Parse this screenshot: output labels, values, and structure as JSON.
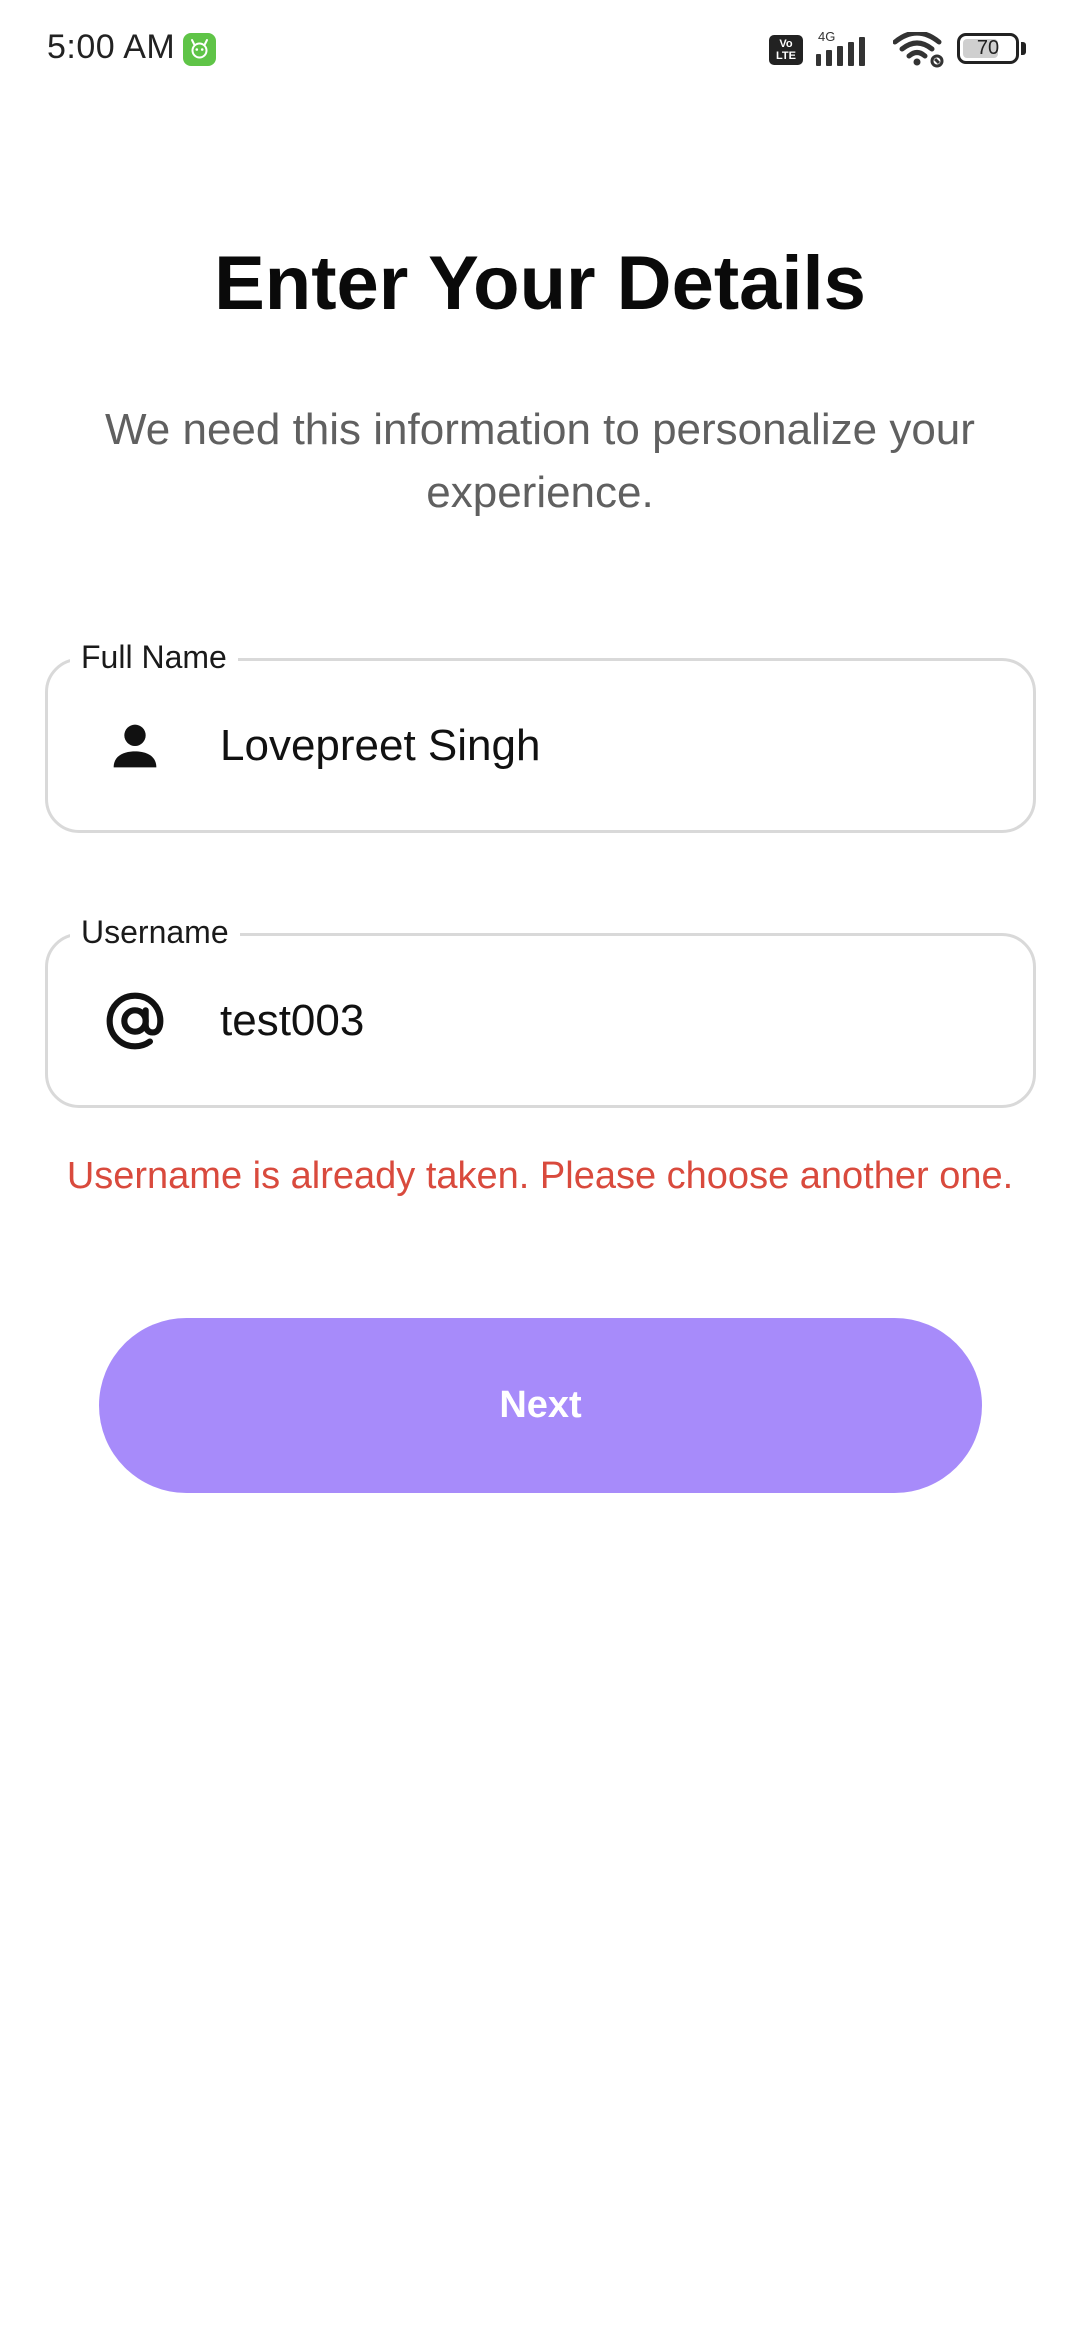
{
  "status_bar": {
    "time": "5:00 AM",
    "volte_label": "Vo\nLTE",
    "network_type": "4G",
    "battery_level": "70",
    "battery_fraction": 0.7,
    "icons": [
      "app-notification-icon",
      "volte-icon",
      "signal-icon",
      "wifi-icon",
      "battery-icon"
    ]
  },
  "header": {
    "title": "Enter Your Details",
    "subtitle": "We need this information to personalize your experience."
  },
  "form": {
    "full_name": {
      "label": "Full Name",
      "value": "Lovepreet Singh",
      "icon": "person-icon"
    },
    "username": {
      "label": "Username",
      "value": "test003",
      "icon": "at-sign-icon"
    },
    "error": "Username is already taken. Please choose another one."
  },
  "actions": {
    "next_label": "Next"
  },
  "colors": {
    "accent": "#a78bfa",
    "error": "#d94a3d",
    "subtitle": "#606060",
    "field_border": "#d9d9d9",
    "notification_green": "#5fc447"
  }
}
